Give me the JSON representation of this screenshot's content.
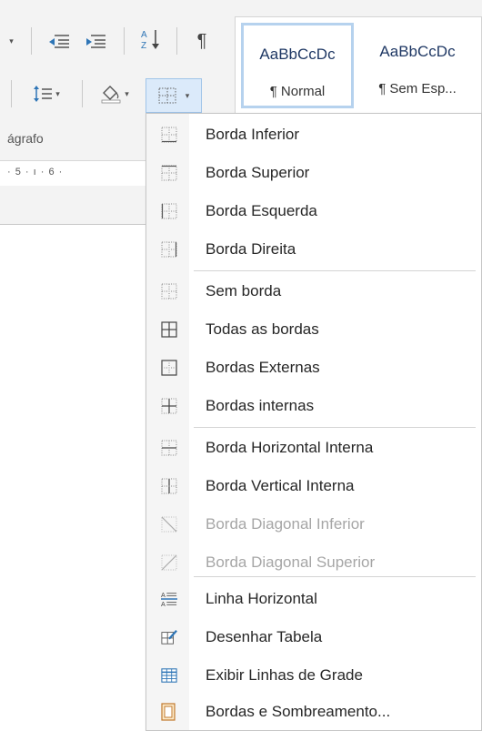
{
  "ribbon": {
    "group_label": "ágrafo",
    "ruler_text": "· 5 · ı · 6 ·",
    "styles": [
      {
        "sample": "AaBbCcDc",
        "name": "¶ Normal"
      },
      {
        "sample": "AaBbCcDc",
        "name": "¶ Sem Esp..."
      }
    ],
    "tools": {
      "sort_icon": "sort-az-icon",
      "pilcrow": "¶",
      "caret": "▾"
    }
  },
  "menu": {
    "items": [
      {
        "label": "Borda Inferior",
        "icon": "border-bottom-icon",
        "disabled": false
      },
      {
        "label": "Borda Superior",
        "icon": "border-top-icon",
        "disabled": false
      },
      {
        "label": "Borda Esquerda",
        "icon": "border-left-icon",
        "disabled": false
      },
      {
        "label": "Borda Direita",
        "icon": "border-right-icon",
        "disabled": false
      },
      {
        "label": "Sem borda",
        "icon": "no-border-icon",
        "disabled": false
      },
      {
        "label": "Todas as bordas",
        "icon": "all-borders-icon",
        "disabled": false
      },
      {
        "label": "Bordas Externas",
        "icon": "outside-borders-icon",
        "disabled": false
      },
      {
        "label": "Bordas internas",
        "icon": "inside-borders-icon",
        "disabled": false
      },
      {
        "label": "Borda Horizontal Interna",
        "icon": "inside-horizontal-border-icon",
        "disabled": false
      },
      {
        "label": "Borda Vertical Interna",
        "icon": "inside-vertical-border-icon",
        "disabled": false
      },
      {
        "label": "Borda Diagonal Inferior",
        "icon": "diagonal-down-border-icon",
        "disabled": true
      },
      {
        "label": "Borda Diagonal Superior",
        "icon": "diagonal-up-border-icon",
        "disabled": true
      },
      {
        "label": "Linha Horizontal",
        "icon": "horizontal-line-icon",
        "disabled": false
      },
      {
        "label": "Desenhar Tabela",
        "icon": "draw-table-icon",
        "disabled": false
      },
      {
        "label": "Exibir Linhas de Grade",
        "icon": "view-gridlines-icon",
        "disabled": false
      },
      {
        "label": "Bordas e Sombreamento...",
        "icon": "borders-shading-icon",
        "disabled": false
      }
    ]
  },
  "colors": {
    "accent": "#2e75b6",
    "highlight": "#dbeafa",
    "disabled_text": "#a6a6a6"
  }
}
